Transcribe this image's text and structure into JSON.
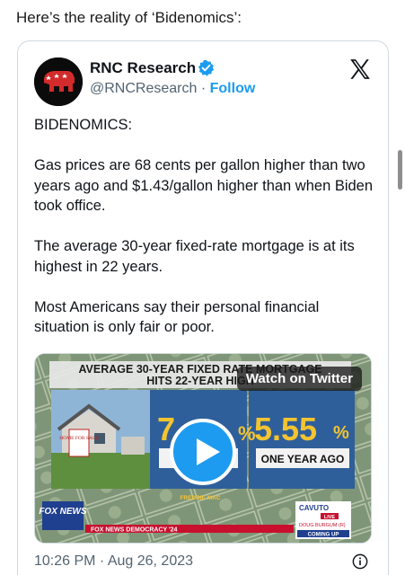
{
  "intro": "Here’s the reality of ‘Bidenomics’:",
  "tweet": {
    "author_name": "RNC Research",
    "handle": "@RNCResearch",
    "separator": "·",
    "follow_label": "Follow",
    "text": "BIDENOMICS:\n\nGas prices are 68 cents per gallon higher than two years ago and $1.43/gallon higher than when Biden took office.\n\nThe average 30-year fixed-rate mortgage is at its highest in 22 years.\n\nMost Americans say their personal financial situation is only fair or poor.",
    "timestamp": "10:26 PM · Aug 26, 2023"
  },
  "media": {
    "watch_label": "Watch on Twitter",
    "headline_line1": "AVERAGE 30-YEAR FIXED RATE MORTGAGE",
    "headline_line2": "HITS 22-YEAR HIGH",
    "current_rate_partial": "7",
    "year_ago_rate": "5.55",
    "percent_sign": "%",
    "year_ago_label": "ONE YEAR AGO",
    "source": "FREDDIE MAC",
    "sign_text": "HOME FOR SALE",
    "network": "FOX NEWS",
    "show": "CAVUTO",
    "live_badge": "LIVE",
    "guest_name": "DOUG BURGUM (R)",
    "coming_up": "COMING UP",
    "ticker_text": "FOX NEWS  DEMOCRACY '24",
    "colors": {
      "panel": "#2f5f9a",
      "rate": "#f4c430",
      "fox_blue": "#1f3f8f",
      "fox_red": "#c8102e"
    }
  },
  "icons": {
    "avatar": "republican-elephant-logo",
    "verified": "verified-badge-icon",
    "x": "x-logo-icon",
    "info": "info-icon",
    "play": "play-icon"
  }
}
